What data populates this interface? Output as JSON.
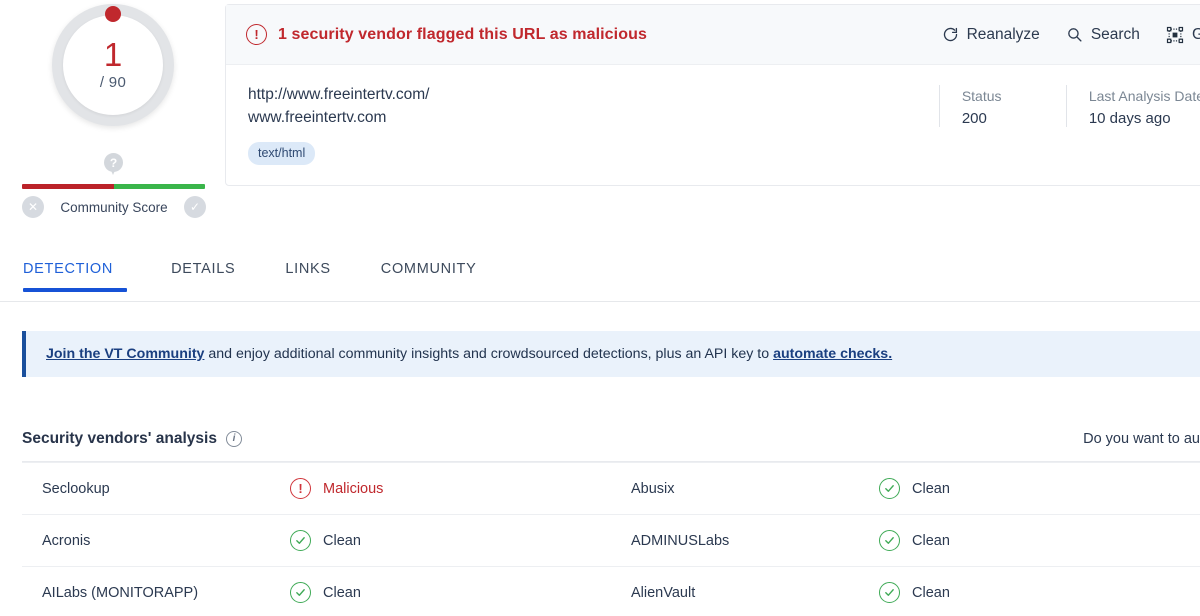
{
  "score": {
    "value": "1",
    "total": "/ 90",
    "community_label": "Community Score",
    "help_marker": "?",
    "dislike_icon": "close-icon",
    "like_icon": "check-icon",
    "accent_red": "#c0282d",
    "accent_green": "#3ab54a"
  },
  "alert": {
    "message": "1 security vendor flagged this URL as malicious",
    "icon": "exclamation-circle-icon",
    "color": "#c0282d"
  },
  "actions": [
    {
      "label": "Reanalyze",
      "icon": "refresh-icon"
    },
    {
      "label": "Search",
      "icon": "search-icon"
    },
    {
      "label": "G",
      "icon": "graph-icon"
    }
  ],
  "target": {
    "url": "http://www.freeintertv.com/",
    "host": "www.freeintertv.com",
    "tags": [
      "text/html"
    ]
  },
  "meta": [
    {
      "label": "Status",
      "value": "200"
    },
    {
      "label": "Last Analysis Date",
      "value": "10 days ago"
    }
  ],
  "tabs": [
    {
      "label": "DETECTION",
      "active": true
    },
    {
      "label": "DETAILS",
      "active": false
    },
    {
      "label": "LINKS",
      "active": false
    },
    {
      "label": "COMMUNITY",
      "active": false
    }
  ],
  "join_banner": {
    "link_start": "Join the VT Community",
    "middle": " and enjoy additional community insights and crowdsourced detections, plus an API key to ",
    "link_end": "automate checks."
  },
  "vendors_section": {
    "title": "Security vendors' analysis",
    "info_icon": "info-icon",
    "aside_text": "Do you want to au"
  },
  "vendor_rows": [
    {
      "left": {
        "name": "Seclookup",
        "result": "Malicious",
        "state": "malicious"
      },
      "right": {
        "name": "Abusix",
        "result": "Clean",
        "state": "clean"
      }
    },
    {
      "left": {
        "name": "Acronis",
        "result": "Clean",
        "state": "clean"
      },
      "right": {
        "name": "ADMINUSLabs",
        "result": "Clean",
        "state": "clean"
      }
    },
    {
      "left": {
        "name": "AILabs (MONITORAPP)",
        "result": "Clean",
        "state": "clean"
      },
      "right": {
        "name": "AlienVault",
        "result": "Clean",
        "state": "clean"
      }
    }
  ]
}
